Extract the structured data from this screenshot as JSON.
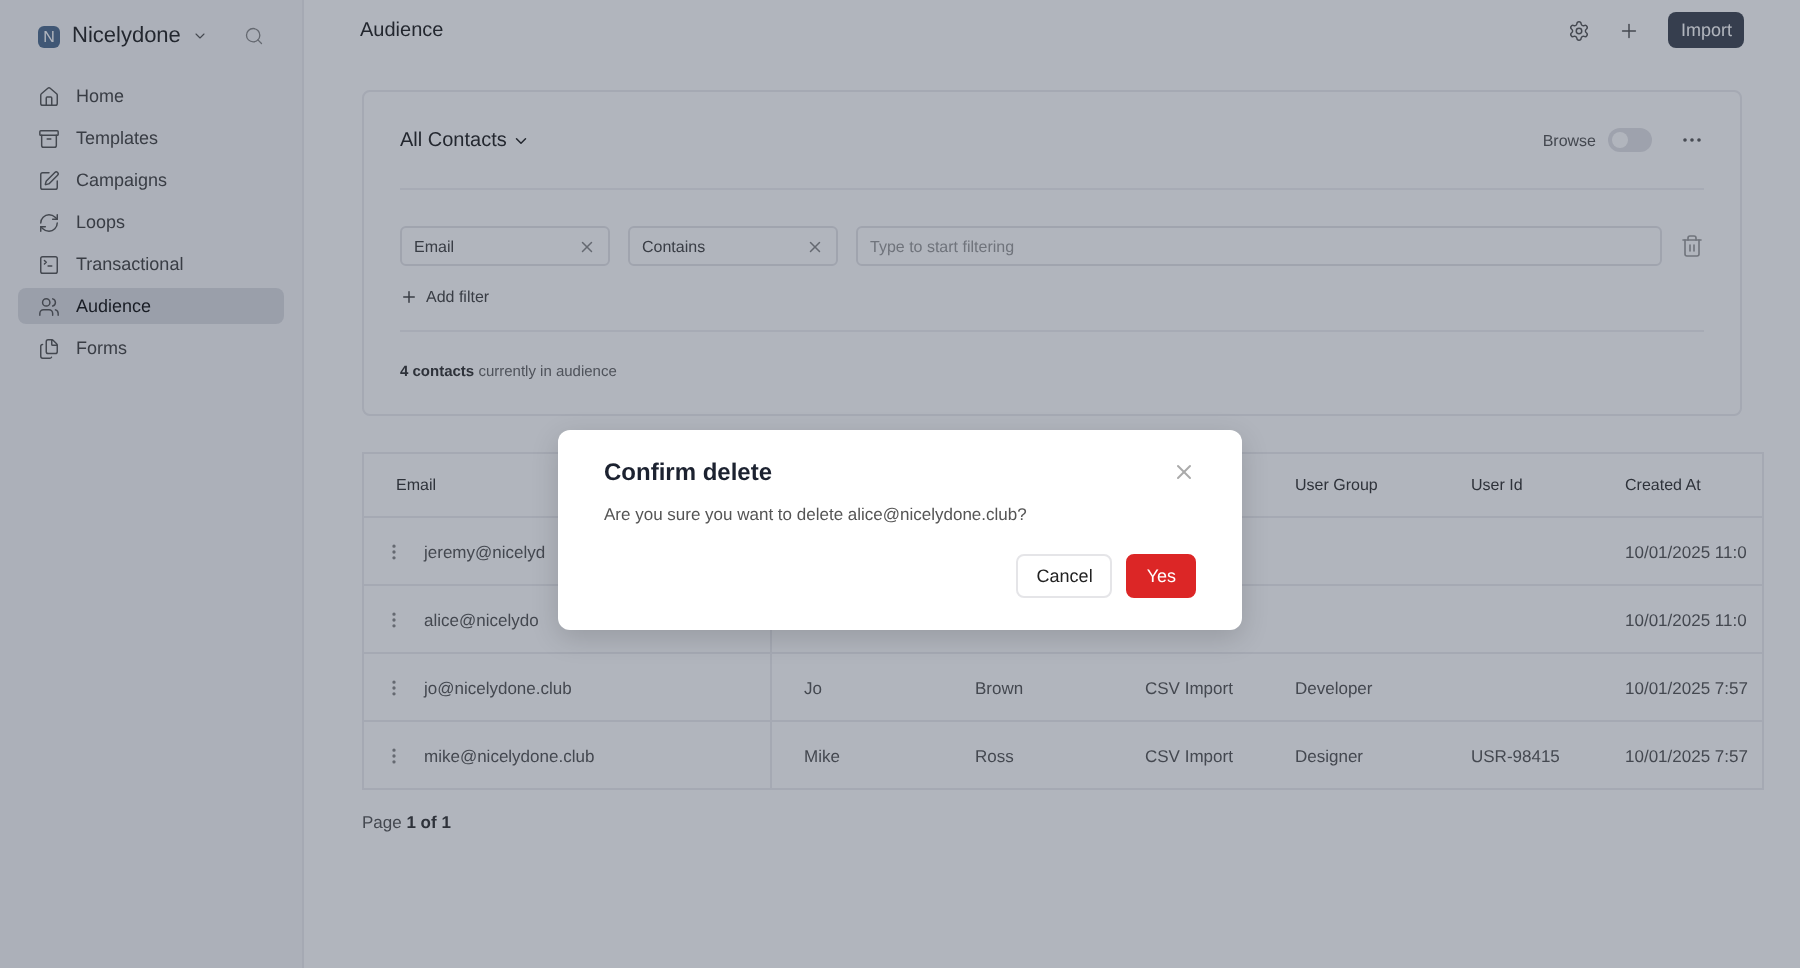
{
  "sidebar": {
    "workspace": {
      "initial": "N",
      "name": "Nicelydone"
    },
    "items": [
      {
        "label": "Home",
        "selected": false
      },
      {
        "label": "Templates",
        "selected": false
      },
      {
        "label": "Campaigns",
        "selected": false
      },
      {
        "label": "Loops",
        "selected": false
      },
      {
        "label": "Transactional",
        "selected": false
      },
      {
        "label": "Audience",
        "selected": true
      },
      {
        "label": "Forms",
        "selected": false
      }
    ]
  },
  "header": {
    "title": "Audience",
    "import_button": "Import"
  },
  "audience_card": {
    "view": "All Contacts",
    "browse_label": "Browse",
    "browse_on": false,
    "filters": [
      {
        "value": "Email"
      },
      {
        "value": "Contains"
      }
    ],
    "filter_placeholder": "Type to start filtering",
    "add_filter": "Add filter",
    "summary": "**4 contacts** currently in audience"
  },
  "table": {
    "columns": [
      "Email",
      null,
      null,
      null,
      "User Group",
      "User Id",
      "Created At"
    ],
    "rows": [
      [
        "jeremy@nicelyd",
        null,
        null,
        null,
        null,
        null,
        "10/01/2025 11:0"
      ],
      [
        "alice@nicelydo",
        null,
        null,
        null,
        null,
        null,
        "10/01/2025 11:0"
      ],
      [
        "jo@nicelydone.club",
        "Jo",
        "Brown",
        "CSV Import",
        "Developer",
        null,
        "10/01/2025 7:57"
      ],
      [
        "mike@nicelydone.club",
        "Mike",
        "Ross",
        "CSV Import",
        "Designer",
        "USR-98415",
        "10/01/2025 7:57"
      ]
    ]
  },
  "pagination": "Page **1 of 1**",
  "dialog": {
    "title": "Confirm delete",
    "message": "Are you sure you want to delete alice@nicelydone.club?",
    "cancel": "Cancel",
    "confirm": "Yes"
  }
}
